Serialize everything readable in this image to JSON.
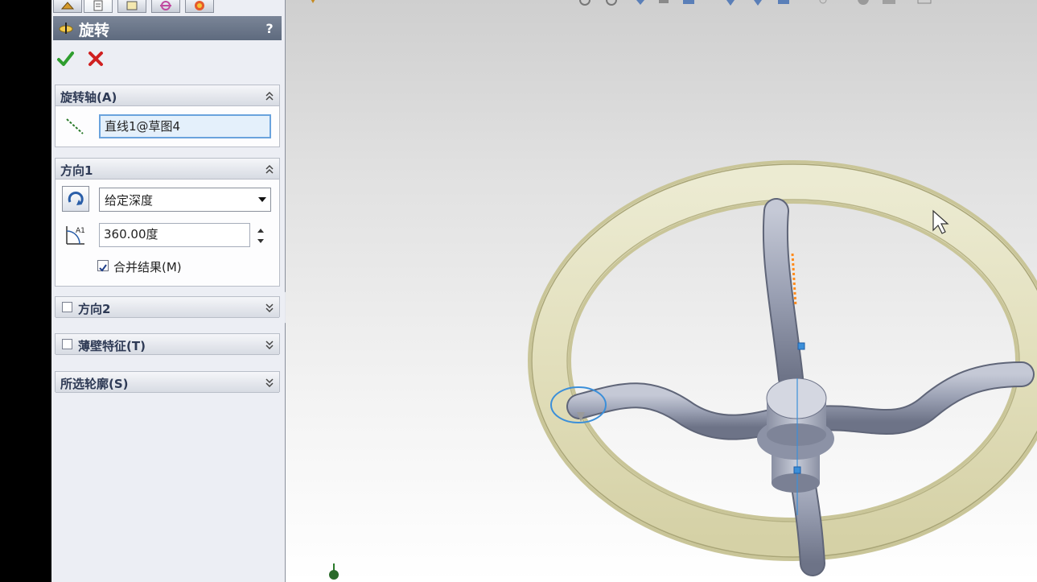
{
  "property_manager": {
    "title": "旋转",
    "help": "?",
    "groups": {
      "axis": {
        "title": "旋转轴(A)",
        "value": "直线1@草图4"
      },
      "direction1": {
        "title": "方向1",
        "end_condition": "给定深度",
        "angle": "360.00度",
        "merge_label": "合并结果(M)",
        "merge_checked": true
      },
      "direction2": {
        "title": "方向2",
        "checked": false
      },
      "thin": {
        "title": "薄壁特征(T)",
        "checked": false
      },
      "contours": {
        "title": "所选轮廓(S)"
      }
    }
  },
  "colors": {
    "wheel_ring": "#e6e3c0",
    "spokes": "#9ea4b6",
    "header": "#6b7689",
    "accent_blue": "#3b8fd9"
  }
}
